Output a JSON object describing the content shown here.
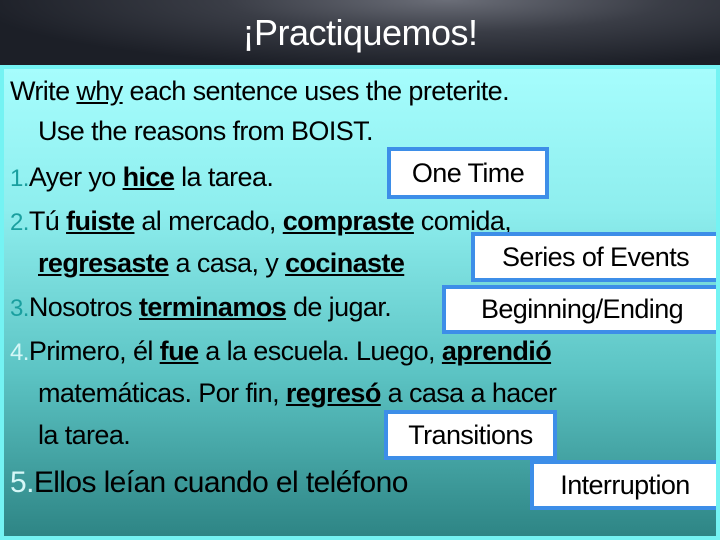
{
  "slide": {
    "title": "¡Practiquemos!",
    "colors": {
      "accent_border": "#3d8ee8",
      "panel_top": "#a6fdfd",
      "panel_bottom": "#2e8585",
      "number_teal": "#1a9f9f",
      "number_light": "#d5f7f7"
    },
    "lines": [
      {
        "num": "",
        "segments": [
          {
            "t": "Write ",
            "s": ""
          },
          {
            "t": "why",
            "s": "u"
          },
          {
            "t": " each sentence uses the preterite.",
            "s": ""
          }
        ]
      },
      {
        "num": "",
        "segments": [
          {
            "t": "Use the reasons from BOIST.",
            "s": ""
          }
        ]
      },
      {
        "num": "1.",
        "segments": [
          {
            "t": "Ayer yo ",
            "s": ""
          },
          {
            "t": "hice",
            "s": "b"
          },
          {
            "t": " la tarea.",
            "s": ""
          }
        ]
      },
      {
        "num": "2.",
        "segments": [
          {
            "t": "Tú ",
            "s": ""
          },
          {
            "t": "fuiste",
            "s": "b"
          },
          {
            "t": " al mercado, ",
            "s": ""
          },
          {
            "t": "compraste",
            "s": "b"
          },
          {
            "t": " comida,",
            "s": ""
          }
        ]
      },
      {
        "num": "",
        "segments": [
          {
            "t": "regresaste",
            "s": "b"
          },
          {
            "t": " a casa, y ",
            "s": ""
          },
          {
            "t": "cocinaste",
            "s": "b"
          }
        ]
      },
      {
        "num": "3.",
        "segments": [
          {
            "t": "Nosotros ",
            "s": ""
          },
          {
            "t": "terminamos",
            "s": "b"
          },
          {
            "t": " de jugar.",
            "s": ""
          }
        ]
      },
      {
        "num": "4.",
        "segments": [
          {
            "t": "Primero, él ",
            "s": ""
          },
          {
            "t": "fue",
            "s": "b"
          },
          {
            "t": " a la escuela.  Luego, ",
            "s": ""
          },
          {
            "t": "aprendió",
            "s": "b"
          }
        ]
      },
      {
        "num": "",
        "segments": [
          {
            "t": "matemáticas.  Por fin, ",
            "s": ""
          },
          {
            "t": "regresó",
            "s": "b"
          },
          {
            "t": " a casa a hacer",
            "s": ""
          }
        ]
      },
      {
        "num": "",
        "segments": [
          {
            "t": "la tarea.",
            "s": ""
          }
        ]
      },
      {
        "num": "5.",
        "segments": [
          {
            "t": "Ellos leían cuando el teléfono",
            "s": ""
          }
        ]
      }
    ],
    "answers": [
      "One Time",
      "Series of Events",
      "Beginning/Ending",
      "Transitions",
      "Interruption"
    ]
  }
}
